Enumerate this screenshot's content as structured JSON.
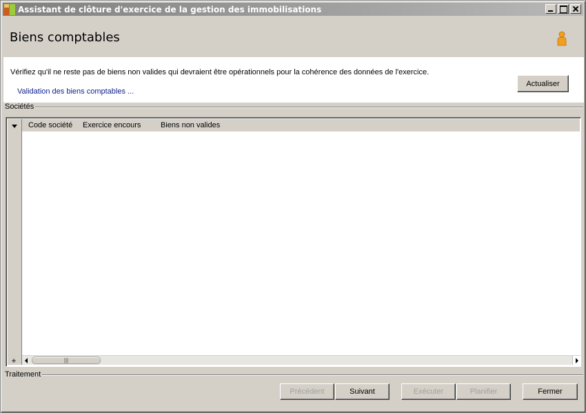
{
  "window": {
    "title": "Assistant de clôture d'exercice de la gestion des immobilisations"
  },
  "header": {
    "title": "Biens comptables",
    "icon": "person-icon"
  },
  "content": {
    "instruction": "Vérifiez qu'il ne reste pas de biens non valides qui devraient être opérationnels pour la cohérence des données de l'exercice.",
    "link": "Validation des biens comptables ...",
    "refresh_button": "Actualiser"
  },
  "companies": {
    "group_label": "Sociétés",
    "columns": [
      "Code société",
      "Exercice encours",
      "Biens non valides"
    ],
    "rows": [],
    "add_glyph": "+",
    "scroll_thumb_glyph": "|||"
  },
  "processing": {
    "group_label": "Traitement"
  },
  "footer": {
    "previous": "Précédent",
    "next": "Suivant",
    "execute": "Exécuter",
    "schedule": "Planifier",
    "close": "Fermer"
  },
  "colors": {
    "window_bg": "#d4d0c8",
    "titlebar_start": "#808080",
    "titlebar_end": "#b8b8b8",
    "link": "#0a1f8c",
    "person_icon": "#f0a020"
  }
}
